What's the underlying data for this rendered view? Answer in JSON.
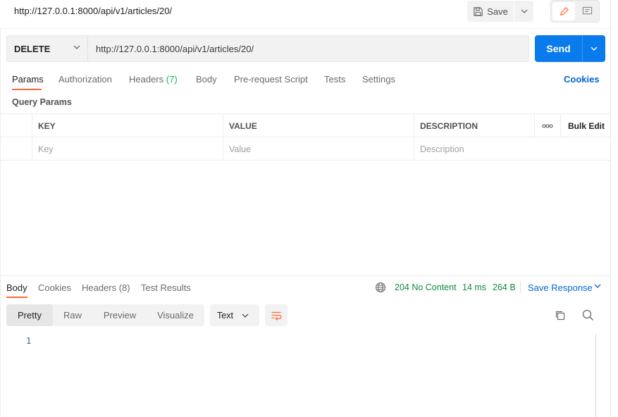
{
  "request": {
    "title": "http://127.0.0.1:8000/api/v1/articles/20/",
    "save_label": "Save",
    "method": "DELETE",
    "url": "http://127.0.0.1:8000/api/v1/articles/20/",
    "send_label": "Send"
  },
  "request_tabs": {
    "params": "Params",
    "authorization": "Authorization",
    "headers": "Headers",
    "headers_count": "(7)",
    "body": "Body",
    "prerequest": "Pre-request Script",
    "tests": "Tests",
    "settings": "Settings",
    "active": "Params"
  },
  "cookies_link": "Cookies",
  "query_params": {
    "title": "Query Params",
    "columns": [
      "KEY",
      "VALUE",
      "DESCRIPTION"
    ],
    "more_icon": "more-horizontal-icon",
    "bulk_edit": "Bulk Edit",
    "placeholders": {
      "key": "Key",
      "value": "Value",
      "description": "Description"
    }
  },
  "response": {
    "tabs": {
      "body": "Body",
      "cookies": "Cookies",
      "headers": "Headers (8)",
      "test_results": "Test Results",
      "active": "Body"
    },
    "status": "204 No Content",
    "time": "14 ms",
    "size": "264 B",
    "save_response": "Save Response",
    "view_modes": [
      "Pretty",
      "Raw",
      "Preview",
      "Visualize"
    ],
    "active_view_mode": "Pretty",
    "format": "Text",
    "line_numbers": [
      "1"
    ]
  },
  "colors": {
    "accent": "#ff6c37",
    "send": "#097bed",
    "link": "#0265d2",
    "status_ok": "#0f8a3c"
  }
}
